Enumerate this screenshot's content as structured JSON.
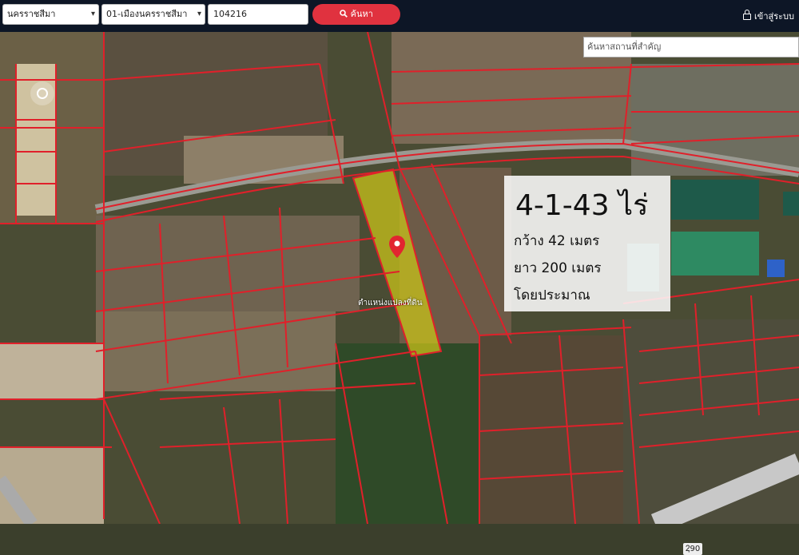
{
  "topbar": {
    "province_select": "นครราชสีมา",
    "district_select": "01-เมืองนครราชสีมา",
    "parcel_number": "104216",
    "search_label": "ค้นหา",
    "login_label": "เข้าสู่ระบบ"
  },
  "map": {
    "place_search_placeholder": "ค้นหาสถานที่สำคัญ",
    "parcel_label": "ตำแหน่งแปลงที่ดิน",
    "road_number": "2ฺ90",
    "info": {
      "area": "4-1-43 ไร่",
      "width": "กว้าง 42 เมตร",
      "length": "ยาว 200 เมตร",
      "approx": "โดยประมาณ"
    }
  },
  "colors": {
    "topbar_bg": "#0d1626",
    "search_button": "#e0323f",
    "parcel_boundary": "#e0202a",
    "selected_parcel": "#c8c21a",
    "pin": "#e22530"
  }
}
